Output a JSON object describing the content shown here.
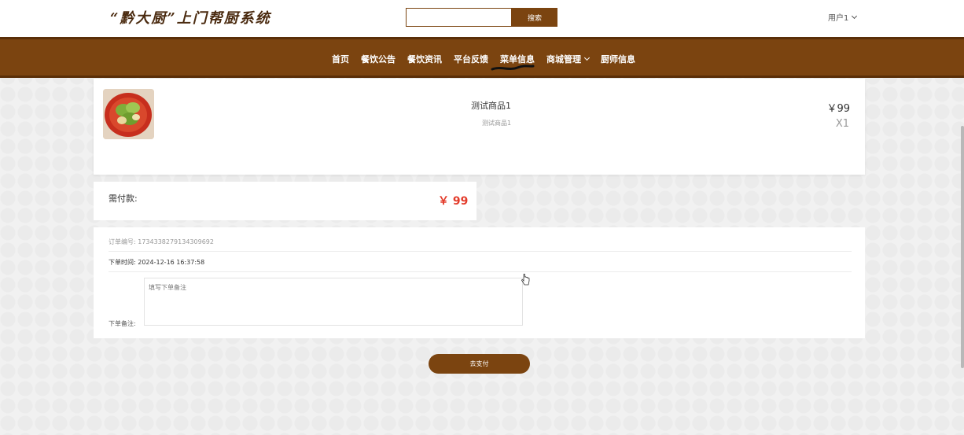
{
  "header": {
    "logo_text": "“黔大厨”上门帮厨系统",
    "search_placeholder": "",
    "search_button": "搜索",
    "user_label": "用户1"
  },
  "nav": {
    "items": [
      "首页",
      "餐饮公告",
      "餐饮资讯",
      "平台反馈",
      "菜单信息"
    ],
    "dropdown_item": "商城管理",
    "last_item": "厨师信息"
  },
  "product": {
    "name": "测试商品1",
    "description": "测试商品1",
    "price": "￥99",
    "quantity": "X1"
  },
  "payment": {
    "label": "需付款:",
    "amount": "￥ 99"
  },
  "order": {
    "number_label": "订单编号:",
    "number_value": "1734338279134309692",
    "time_label": "下单时间:",
    "time_value": "2024-12-16 16:37:58",
    "remark_label": "下单备注:",
    "remark_placeholder": "填写下单备注",
    "remark_value": ""
  },
  "actions": {
    "go_pay": "去支付"
  },
  "colors": {
    "brand": "#7b4410",
    "price_red": "#e33b2a",
    "background": "#f1f1f1"
  }
}
